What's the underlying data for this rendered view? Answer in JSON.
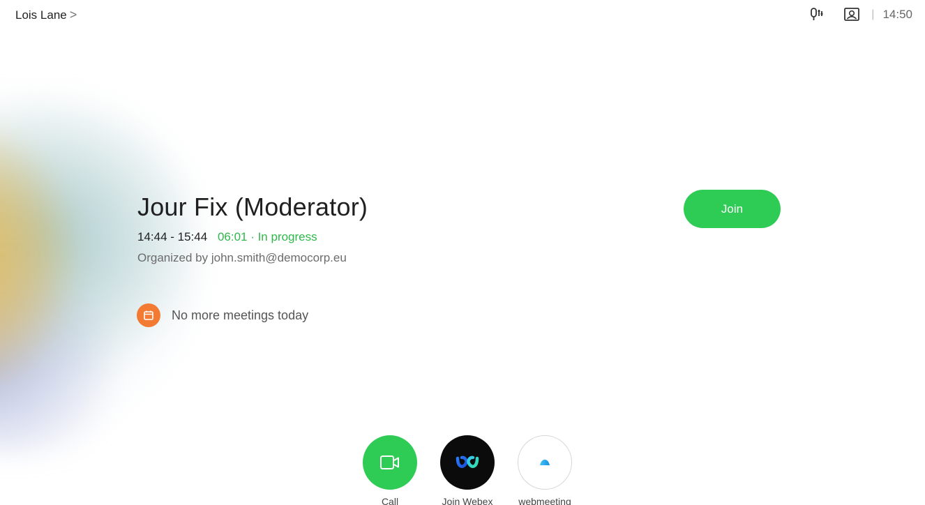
{
  "header": {
    "user_name": "Lois Lane",
    "chevron": ">",
    "mic_icon": "mic-settings-icon",
    "selfview_icon": "self-view-icon",
    "separator": "|",
    "clock": "14:50"
  },
  "meeting": {
    "title": "Jour Fix (Moderator)",
    "time_range": "14:44 - 15:44",
    "elapsed": "06:01 · In progress",
    "organizer": "Organized by john.smith@democorp.eu",
    "join_label": "Join"
  },
  "agenda": {
    "icon": "calendar-icon",
    "message": "No more meetings today"
  },
  "dock": {
    "items": [
      {
        "label": "Call",
        "icon": "video-camera-icon",
        "color": "#2ecc55"
      },
      {
        "label": "Join Webex",
        "icon": "webex-logo-icon",
        "color": "#0b0b0b"
      },
      {
        "label": "webmeeting",
        "icon": "webmeeting-logo-icon",
        "color": "#ffffff"
      }
    ]
  },
  "colors": {
    "accent_green": "#2ecc55",
    "progress_green": "#2eb84a",
    "calendar_orange": "#f27a33"
  }
}
